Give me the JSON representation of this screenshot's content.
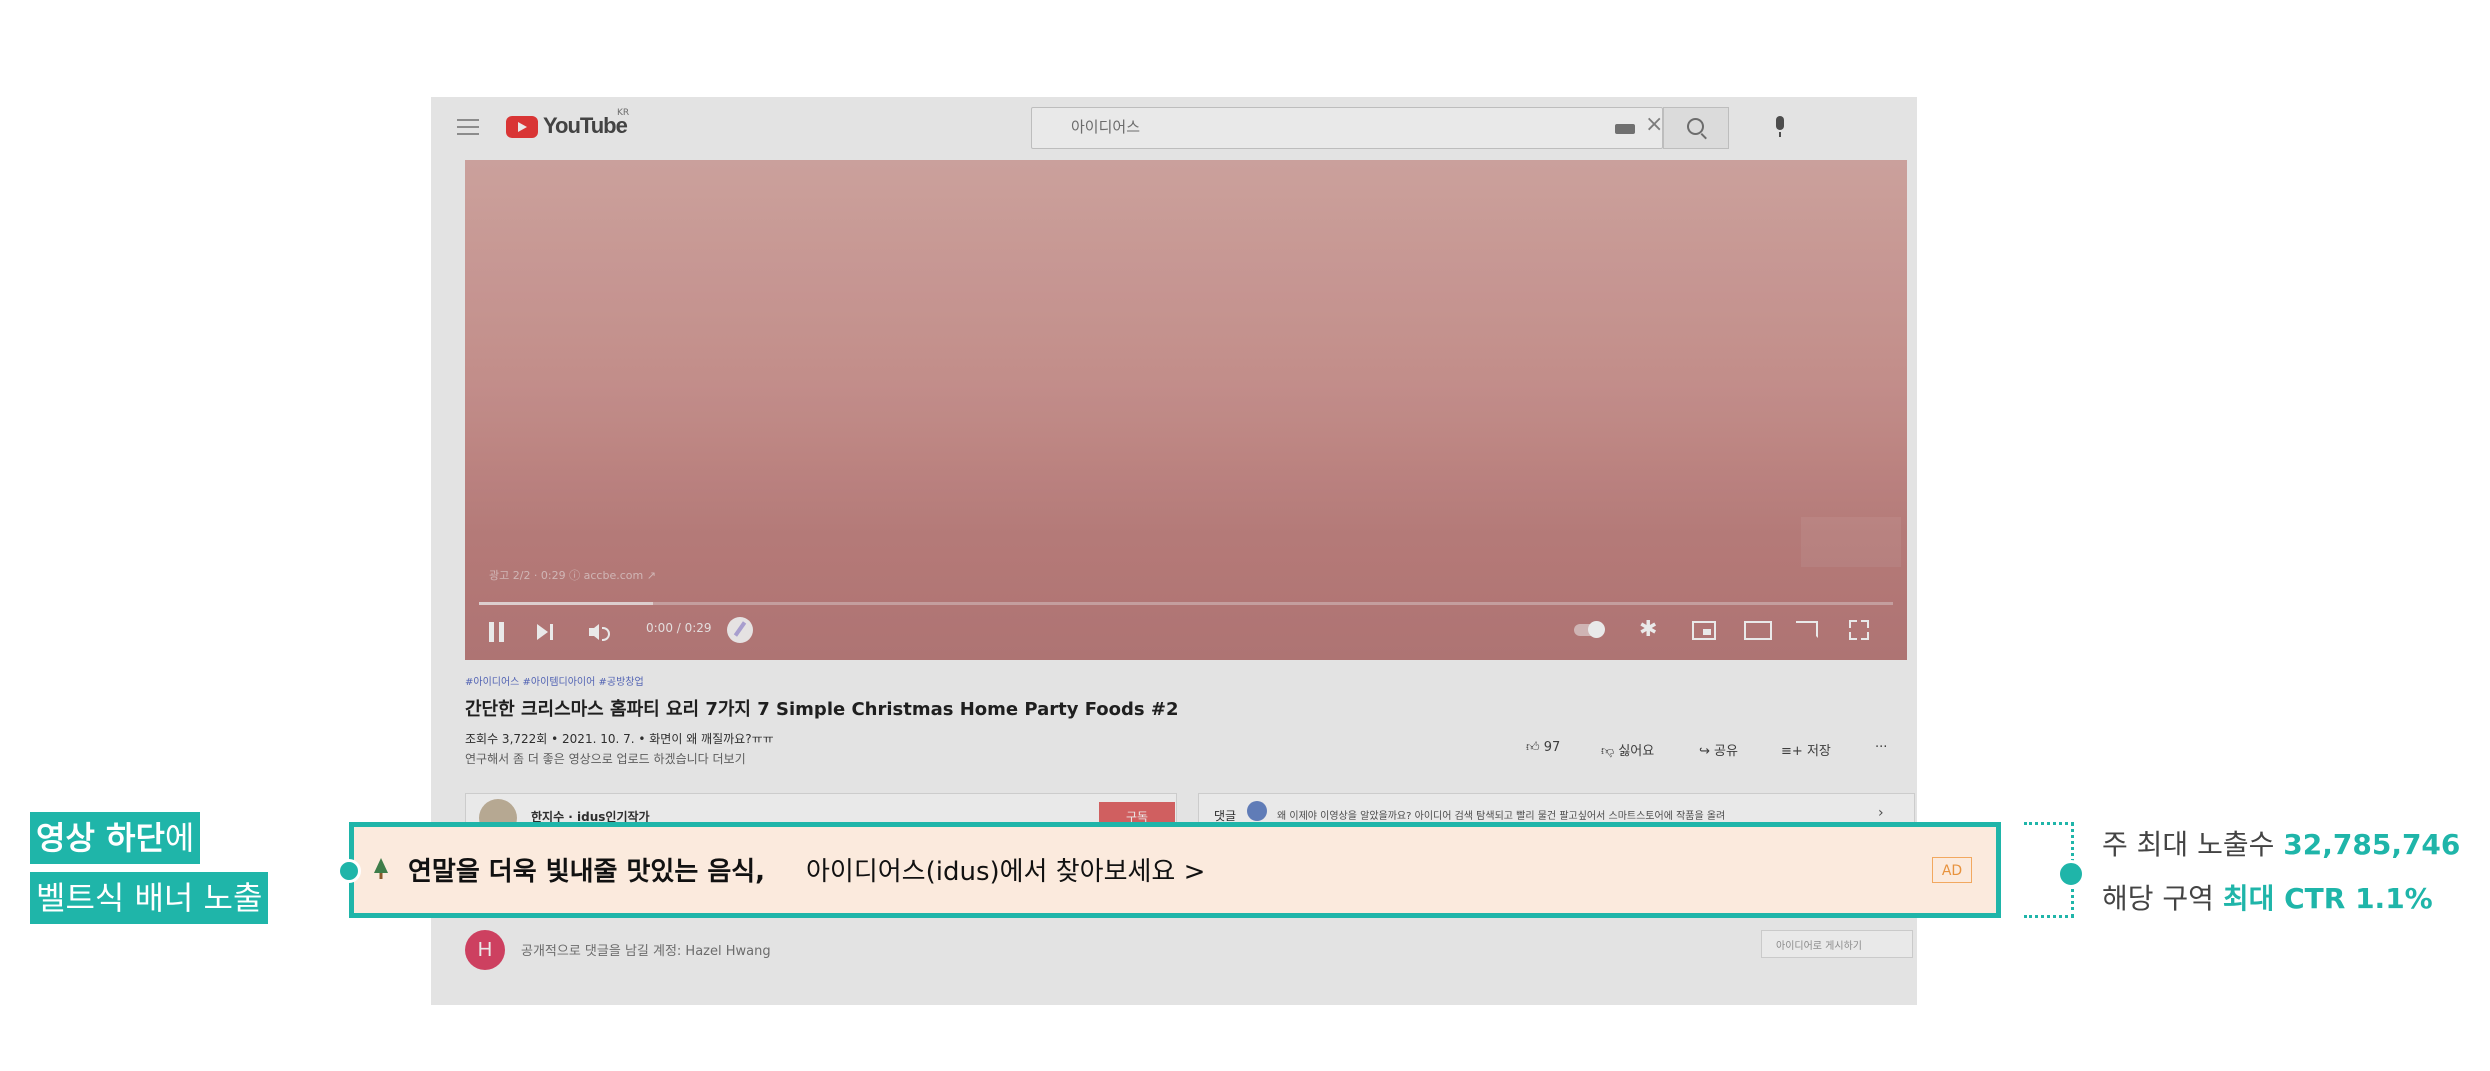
{
  "youtube": {
    "logo_text": "YouTube",
    "logo_superscript": "KR",
    "search": {
      "value": "아이디어스"
    },
    "player": {
      "overlay_text": "광고 2/2 · 0:29 ⓘ  accbe.com ↗",
      "time": "0:00 / 0:29"
    },
    "video": {
      "hashtags": "#아이디어스 #아이템디아이어 #공방창업",
      "title": "간단한 크리스마스 홈파티 요리 7가지 7 Simple Christmas Home Party Foods #2",
      "meta": "조회수 3,722회 • 2021. 10. 7. • 화면이 왜 깨질까요?ㅠㅠ",
      "desc": "연구해서 좀 더 좋은 영상으로 업로드 하겠습니다 더보기",
      "likes": "97",
      "dislike_label": "싫어요",
      "share_label": "공유",
      "save_label": "저장",
      "more": "···"
    },
    "channel": {
      "name": "한지수 · idus인기작가",
      "subscribe": "구독"
    },
    "comments": {
      "label": "댓글",
      "preview": "왜 이제야 이영상을 알았을까요? 아이디어 검색 탐색되고 빨리 물건 팔고싶어서 스마트스토어에 작품을 올려",
      "arrow": "›"
    },
    "comment_box": {
      "avatar_letter": "H",
      "placeholder": "공개적으로 댓글을 남길 계정: Hazel Hwang",
      "right_button": "아이디어로 게시하기"
    }
  },
  "banner": {
    "bold_text": "연말을 더욱 빛내줄 맛있는 음식,",
    "regular_text": "아이디어스(idus)에서 찾아보세요  >",
    "ad_badge": "AD"
  },
  "left_label": {
    "line1_bold": "영상 하단",
    "line1_rest": "에",
    "line2": "벨트식 배너 노출"
  },
  "stats": {
    "line1_prefix": "주 최대 노출수 ",
    "line1_value": "32,785,746",
    "line2_prefix": "해당 구역 ",
    "line2_value": "최대 CTR 1.1%"
  },
  "colors": {
    "accent": "#1fb5a9",
    "banner_bg": "#fbeadd",
    "ad_badge": "#e8933e"
  }
}
